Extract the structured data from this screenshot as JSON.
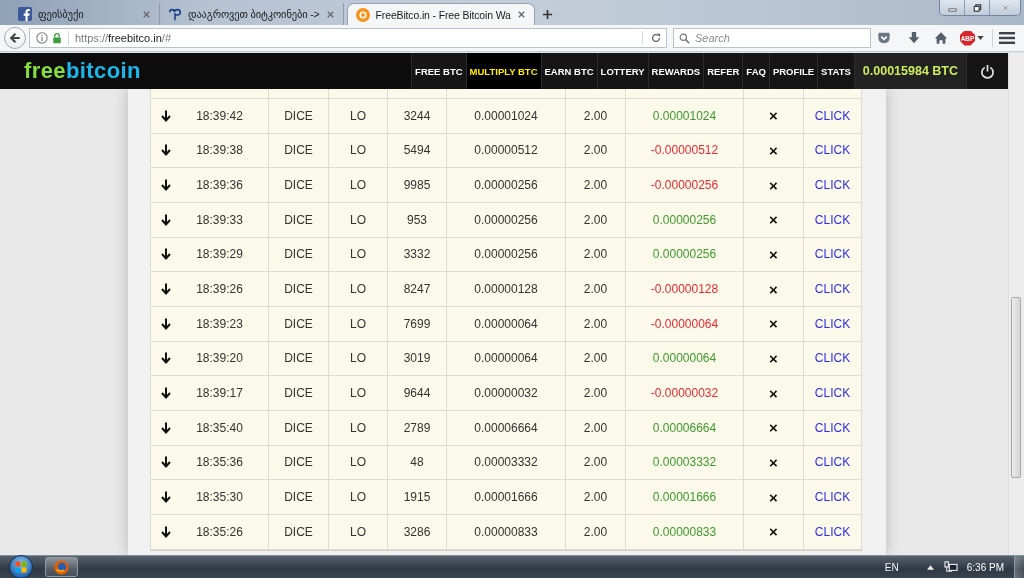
{
  "browser": {
    "tabs": [
      {
        "title": "ფეისბუქი",
        "selected": false
      },
      {
        "title": "დააგროვეთ ბიტკოინები ->",
        "selected": false
      },
      {
        "title": "FreeBitco.in - Free Bitcoin Wa",
        "selected": true
      }
    ],
    "address": {
      "scheme": "https://",
      "host": "freebitco.in",
      "path": "/#"
    },
    "search": {
      "placeholder": "Search"
    },
    "adblock_badge": "ABP"
  },
  "site": {
    "logo": {
      "first": "free",
      "second": "bitcoin"
    },
    "nav": [
      {
        "label": "FREE BTC",
        "selected": false
      },
      {
        "label": "MULTIPLY BTC",
        "selected": true
      },
      {
        "label": "EARN BTC",
        "selected": false
      },
      {
        "label": "LOTTERY",
        "selected": false
      },
      {
        "label": "REWARDS",
        "selected": false
      },
      {
        "label": "REFER",
        "selected": false
      },
      {
        "label": "FAQ",
        "selected": false
      },
      {
        "label": "PROFILE",
        "selected": false
      },
      {
        "label": "STATS",
        "selected": false
      }
    ],
    "balance": "0.00015984 BTC"
  },
  "table": {
    "rows": [
      {
        "column_2": "18:39:42",
        "column_3": "DICE",
        "column_4": "LO",
        "column_5": "3244",
        "column_6": "0.00001024",
        "column_7": "2.00",
        "column_8": "0.00001024",
        "positive": true,
        "column_9": "×",
        "column_10": "CLICK"
      },
      {
        "column_2": "18:39:38",
        "column_3": "DICE",
        "column_4": "LO",
        "column_5": "5494",
        "column_6": "0.00000512",
        "column_7": "2.00",
        "column_8": "-0.00000512",
        "positive": false,
        "column_9": "×",
        "column_10": "CLICK"
      },
      {
        "column_2": "18:39:36",
        "column_3": "DICE",
        "column_4": "LO",
        "column_5": "9985",
        "column_6": "0.00000256",
        "column_7": "2.00",
        "column_8": "-0.00000256",
        "positive": false,
        "column_9": "×",
        "column_10": "CLICK"
      },
      {
        "column_2": "18:39:33",
        "column_3": "DICE",
        "column_4": "LO",
        "column_5": "953",
        "column_6": "0.00000256",
        "column_7": "2.00",
        "column_8": "0.00000256",
        "positive": true,
        "column_9": "×",
        "column_10": "CLICK"
      },
      {
        "column_2": "18:39:29",
        "column_3": "DICE",
        "column_4": "LO",
        "column_5": "3332",
        "column_6": "0.00000256",
        "column_7": "2.00",
        "column_8": "0.00000256",
        "positive": true,
        "column_9": "×",
        "column_10": "CLICK"
      },
      {
        "column_2": "18:39:26",
        "column_3": "DICE",
        "column_4": "LO",
        "column_5": "8247",
        "column_6": "0.00000128",
        "column_7": "2.00",
        "column_8": "-0.00000128",
        "positive": false,
        "column_9": "×",
        "column_10": "CLICK"
      },
      {
        "column_2": "18:39:23",
        "column_3": "DICE",
        "column_4": "LO",
        "column_5": "7699",
        "column_6": "0.00000064",
        "column_7": "2.00",
        "column_8": "-0.00000064",
        "positive": false,
        "column_9": "×",
        "column_10": "CLICK"
      },
      {
        "column_2": "18:39:20",
        "column_3": "DICE",
        "column_4": "LO",
        "column_5": "3019",
        "column_6": "0.00000064",
        "column_7": "2.00",
        "column_8": "0.00000064",
        "positive": true,
        "column_9": "×",
        "column_10": "CLICK"
      },
      {
        "column_2": "18:39:17",
        "column_3": "DICE",
        "column_4": "LO",
        "column_5": "9644",
        "column_6": "0.00000032",
        "column_7": "2.00",
        "column_8": "-0.00000032",
        "positive": false,
        "column_9": "×",
        "column_10": "CLICK"
      },
      {
        "column_2": "18:35:40",
        "column_3": "DICE",
        "column_4": "LO",
        "column_5": "2789",
        "column_6": "0.00006664",
        "column_7": "2.00",
        "column_8": "0.00006664",
        "positive": true,
        "column_9": "×",
        "column_10": "CLICK"
      },
      {
        "column_2": "18:35:36",
        "column_3": "DICE",
        "column_4": "LO",
        "column_5": "48",
        "column_6": "0.00003332",
        "column_7": "2.00",
        "column_8": "0.00003332",
        "positive": true,
        "column_9": "×",
        "column_10": "CLICK"
      },
      {
        "column_2": "18:35:30",
        "column_3": "DICE",
        "column_4": "LO",
        "column_5": "1915",
        "column_6": "0.00001666",
        "column_7": "2.00",
        "column_8": "0.00001666",
        "positive": true,
        "column_9": "×",
        "column_10": "CLICK"
      },
      {
        "column_2": "18:35:26",
        "column_3": "DICE",
        "column_4": "LO",
        "column_5": "3286",
        "column_6": "0.00000833",
        "column_7": "2.00",
        "column_8": "0.00000833",
        "positive": true,
        "column_9": "×",
        "column_10": "CLICK"
      }
    ]
  },
  "taskbar": {
    "language": "EN",
    "clock": "6:36 PM"
  }
}
